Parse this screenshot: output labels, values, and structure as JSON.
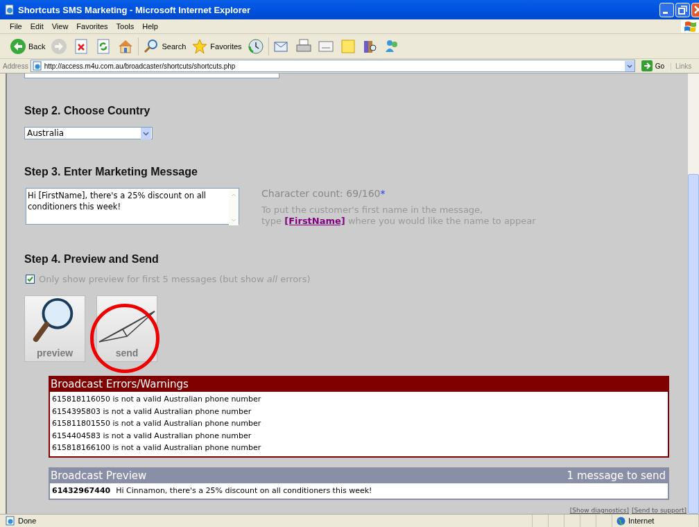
{
  "window": {
    "title": "Shortcuts SMS Marketing - Microsoft Internet Explorer"
  },
  "menu": [
    "File",
    "Edit",
    "View",
    "Favorites",
    "Tools",
    "Help"
  ],
  "toolbar": [
    {
      "kind": "back",
      "label": "Back",
      "disabled": false
    },
    {
      "kind": "forward",
      "disabled": true
    },
    {
      "kind": "stop"
    },
    {
      "kind": "refresh"
    },
    {
      "kind": "home"
    },
    {
      "kind": "search",
      "label": "Search"
    },
    {
      "kind": "favorites",
      "label": "Favorites"
    },
    {
      "kind": "history"
    },
    {
      "kind": "mail"
    },
    {
      "kind": "print"
    },
    {
      "kind": "edit"
    },
    {
      "kind": "note"
    },
    {
      "kind": "research"
    },
    {
      "kind": "messenger"
    }
  ],
  "address": {
    "label": "Address",
    "url": "http://access.m4u.com.au/broadcaster/shortcuts/shortcuts.php",
    "go": "Go",
    "links": "Links"
  },
  "steps": [
    {
      "kind": "country",
      "heading": "Step 2. Choose Country",
      "value": "Australia"
    },
    {
      "kind": "message",
      "heading": "Step 3. Enter Marketing Message",
      "value": "Hi [FirstName], there's a 25% discount on all conditioners this week!",
      "count": "Character count: 69/160",
      "count_mark": "*",
      "hint": "To put the customer's first name in the message,\ntype **[FirstName]** where you would like the name to appear"
    },
    {
      "kind": "send",
      "heading": "Step 4. Preview and Send",
      "option": {
        "label": "Only show preview for first 5 messages (but show *all* errors)",
        "checked": true
      },
      "buttons": [
        {
          "kind": "preview",
          "label": "preview"
        },
        {
          "kind": "send",
          "label": "send",
          "circled": true
        }
      ]
    }
  ],
  "errors": {
    "title": "Broadcast Errors/Warnings",
    "rows": [
      "615818116050 is not a valid Australian phone number",
      "6154395803 is not a valid Australian phone number",
      "615811801550 is not a valid Australian phone number",
      "6154404583 is not a valid Australian phone number",
      "615818166100 is not a valid Australian phone number"
    ]
  },
  "preview": {
    "title": "Broadcast Preview",
    "count": "1 message to send",
    "rows": [
      {
        "number": "61432967440",
        "text": "Hi Cinnamon, there's a 25% discount on all conditioners this week!"
      }
    ]
  },
  "footer_links": [
    "[Show diagnostics]",
    "[Send to support]"
  ],
  "status_bar": {
    "text": "Done",
    "zone": "Internet"
  }
}
